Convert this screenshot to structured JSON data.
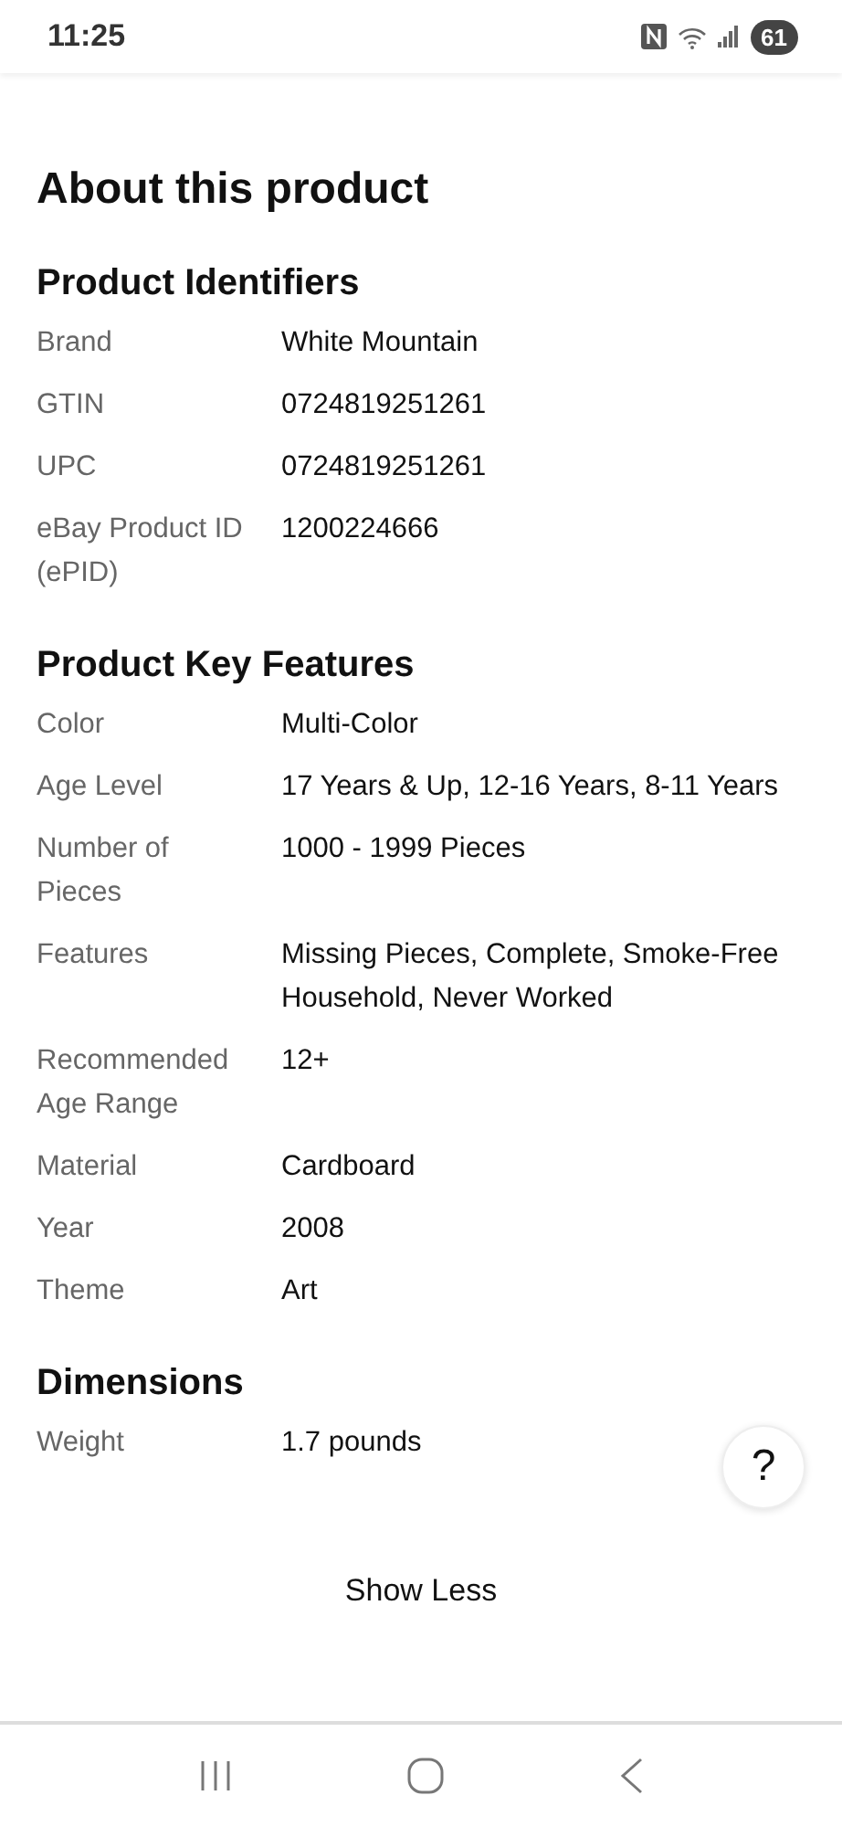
{
  "status_bar": {
    "time": "11:25",
    "battery": "61"
  },
  "title": "About this product",
  "sections": [
    {
      "heading": "Product Identifiers",
      "rows": [
        {
          "label": "Brand",
          "value": "White Mountain"
        },
        {
          "label": "GTIN",
          "value": "0724819251261"
        },
        {
          "label": "UPC",
          "value": "0724819251261"
        },
        {
          "label": "eBay Product ID (ePID)",
          "value": "1200224666"
        }
      ]
    },
    {
      "heading": "Product Key Features",
      "rows": [
        {
          "label": "Color",
          "value": "Multi-Color"
        },
        {
          "label": "Age Level",
          "value": "17 Years & Up, 12-16 Years, 8-11 Years"
        },
        {
          "label": "Number of Pieces",
          "value": "1000 - 1999 Pieces"
        },
        {
          "label": "Features",
          "value": "Missing Pieces, Complete, Smoke-Free Household, Never Worked"
        },
        {
          "label": "Recommended Age Range",
          "value": "12+"
        },
        {
          "label": "Material",
          "value": "Cardboard"
        },
        {
          "label": "Year",
          "value": "2008"
        },
        {
          "label": "Theme",
          "value": "Art"
        }
      ]
    },
    {
      "heading": "Dimensions",
      "rows": [
        {
          "label": "Weight",
          "value": "1.7 pounds"
        }
      ]
    }
  ],
  "help_button": "?",
  "show_less": "Show Less"
}
